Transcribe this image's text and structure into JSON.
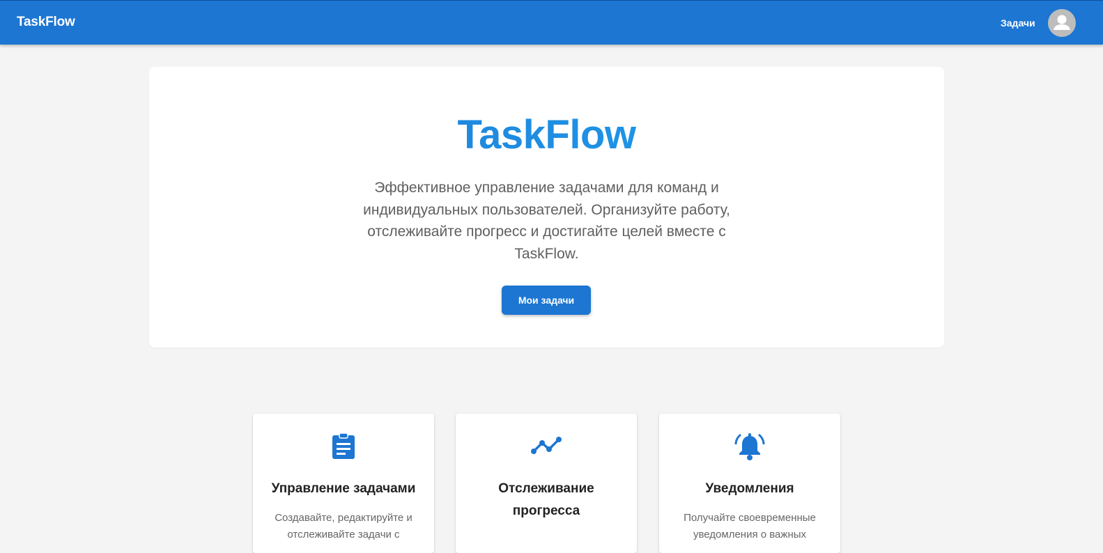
{
  "header": {
    "brand": "TaskFlow",
    "nav_tasks": "Задачи",
    "avatar_icon": "account-circle-icon",
    "color": "#1c76d2"
  },
  "hero": {
    "title": "TaskFlow",
    "subtitle": "Эффективное управление задачами для команд и индивидуальных пользователей. Организуйте работу, отслеживайте прогресс и достигайте целей вместе с TaskFlow.",
    "button_label": "Мои задачи"
  },
  "features": [
    {
      "icon": "clipboard-icon",
      "title": "Управление задачами",
      "description": "Создавайте, редактируйте и отслеживайте задачи с"
    },
    {
      "icon": "timeline-icon",
      "title": "Отслеживание прогресса",
      "description": ""
    },
    {
      "icon": "bell-icon",
      "title": "Уведомления",
      "description": "Получайте своевременные уведомления о важных"
    }
  ]
}
